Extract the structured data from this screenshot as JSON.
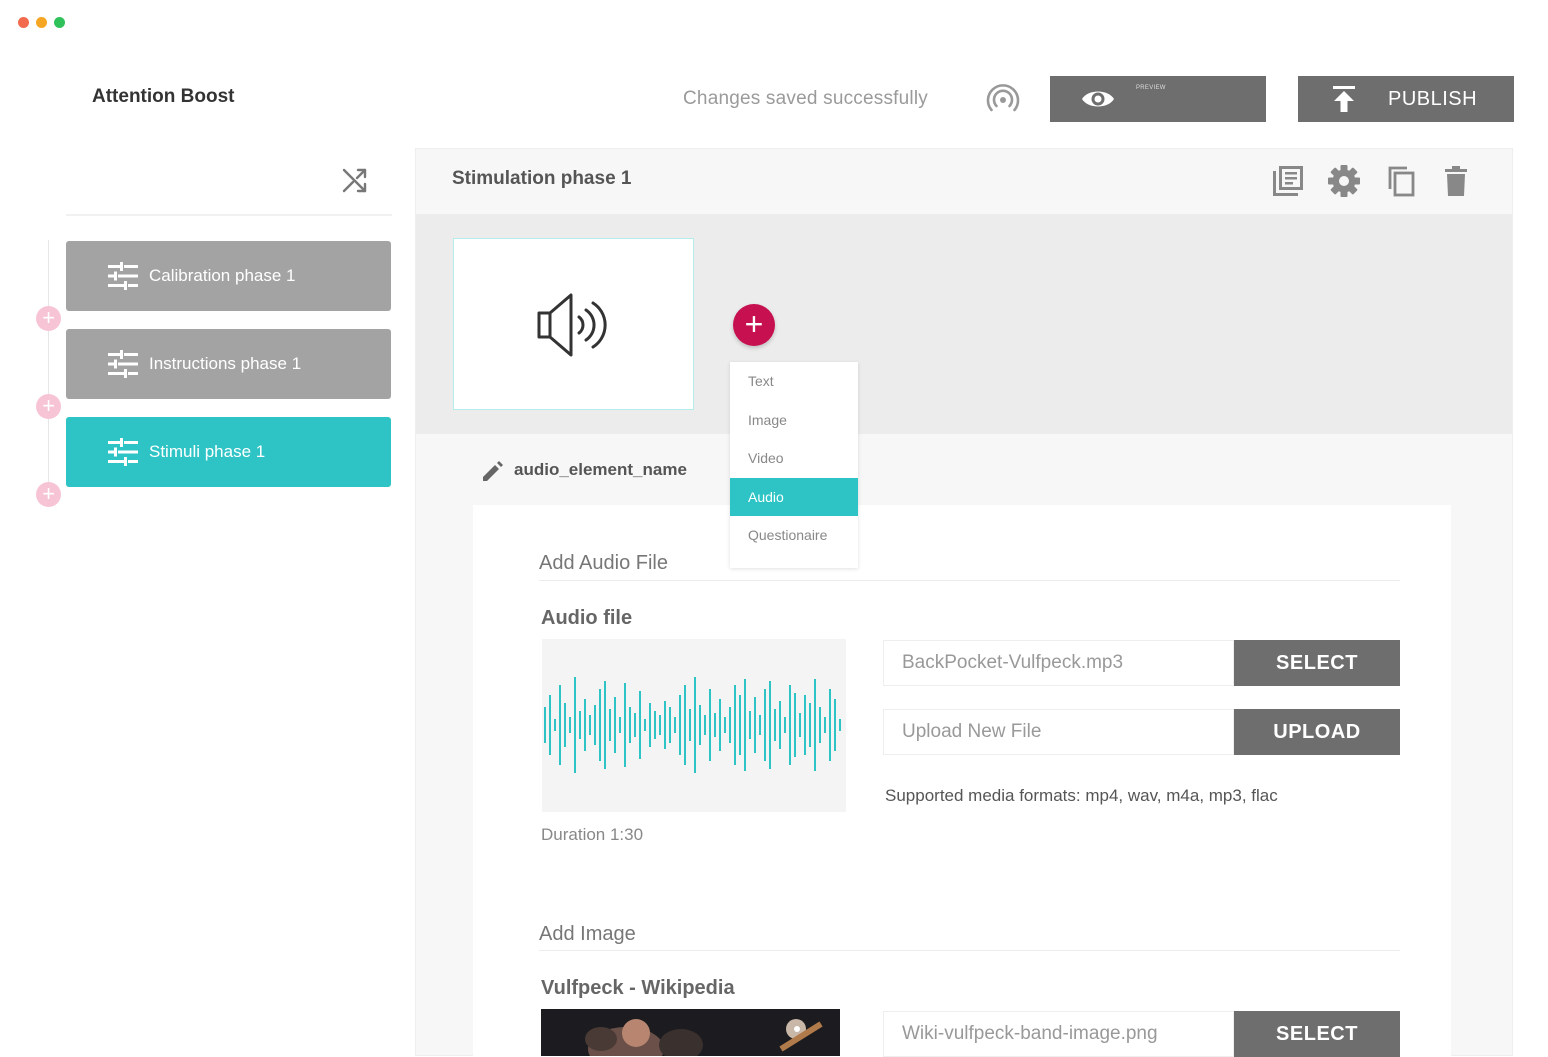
{
  "window": {
    "dot_colors": [
      "#f26b4f",
      "#f5a623",
      "#2fc25b"
    ]
  },
  "header": {
    "app_title": "Attention Boost",
    "save_status": "Changes saved successfully",
    "preview_label": "PREVIEW",
    "publish_label": "PUBLISH"
  },
  "sidebar": {
    "phases": [
      {
        "label": "Calibration phase 1",
        "state": "inactive"
      },
      {
        "label": "Instructions phase 1",
        "state": "inactive"
      },
      {
        "label": "Stimuli phase 1",
        "state": "active"
      }
    ]
  },
  "main": {
    "phase_title": "Stimulation phase 1",
    "toolbar_icons": [
      "library-icon",
      "gear-icon",
      "copy-icon",
      "trash-icon"
    ],
    "element_name": "audio_element_name",
    "add_menu": {
      "items": [
        "Text",
        "Image",
        "Video",
        "Audio",
        "Questionaire"
      ],
      "selected": "Audio"
    },
    "audio_section": {
      "title": "Add Audio File",
      "field_label": "Audio file",
      "current_file": "BackPocket-Vulfpeck.mp3",
      "select_label": "SELECT",
      "upload_placeholder": "Upload New File",
      "upload_label": "UPLOAD",
      "formats_note": "Supported media formats: mp4, wav, m4a, mp3, flac",
      "duration": "Duration 1:30"
    },
    "image_section": {
      "title": "Add Image",
      "field_label": "Vulfpeck - Wikipedia",
      "current_file": "Wiki-vulfpeck-band-image.png",
      "select_label": "SELECT"
    }
  },
  "colors": {
    "accent_teal": "#2ec4c6",
    "add_button": "#c7104f",
    "dark_button": "#6e6e6e",
    "inactive_phase": "#a3a3a3"
  }
}
